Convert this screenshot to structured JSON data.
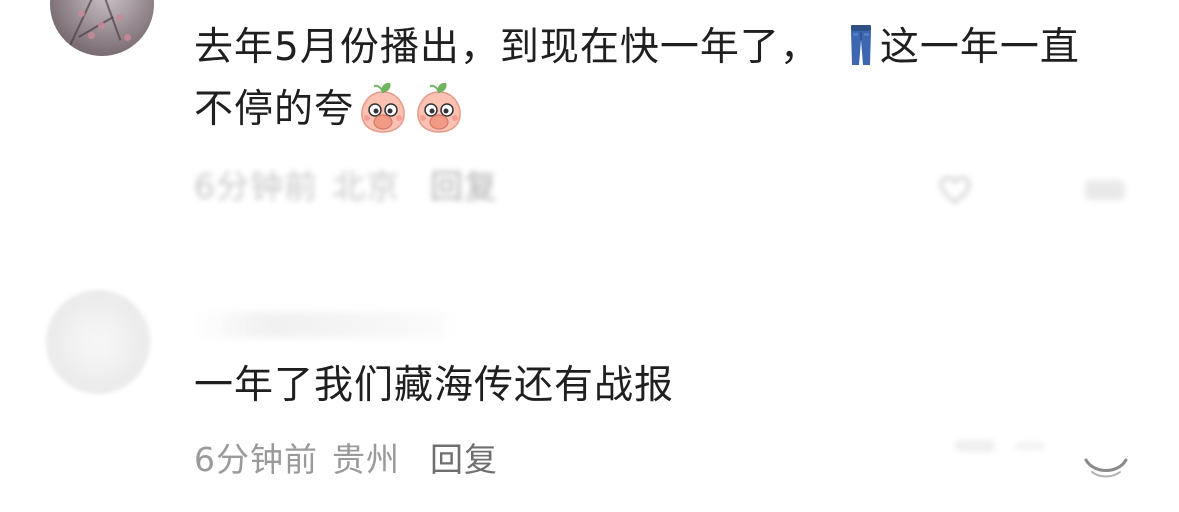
{
  "comments": [
    {
      "text_line1_part1": "去年5月份播出，到现在快一年了，",
      "text_line1_part2": "这一年一直",
      "text_line2": "不停的夸",
      "time": "6分钟前",
      "location": "北京",
      "reply_label": "回复",
      "icons": [
        "jeans-emoji",
        "peach-cover-mouth-emoji",
        "peach-cover-mouth-emoji",
        "heart-icon"
      ]
    },
    {
      "text": "一年了我们藏海传还有战报",
      "time": "6分钟前",
      "location": "贵州",
      "reply_label": "回复",
      "icons": [
        "like-icon"
      ]
    }
  ],
  "colors": {
    "text": "#1f1f1f",
    "meta": "#9a9a9a",
    "reply": "#6f6f6f",
    "background": "#ffffff"
  }
}
